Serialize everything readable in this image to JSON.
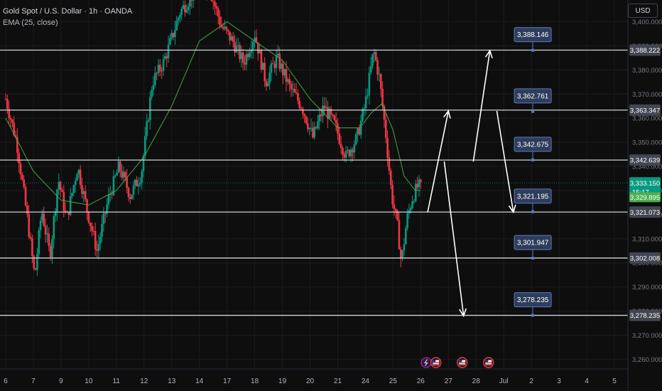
{
  "header": {
    "symbol": "Gold Spot / U.S. Dollar · 1h · OANDA",
    "indicator": "EMA (25, close)"
  },
  "price_scale": {
    "currency": "USD"
  },
  "colors": {
    "background": "#0e0e0e",
    "grid": "#1c1c1c",
    "bull": "#089981",
    "bear": "#f23645",
    "ema": "#4caf50",
    "level_line": "#d1d4dc",
    "label_fill": "#2e3d5b",
    "label_border": "#5b79c2",
    "current_price": "#089981",
    "ema_label": "#4caf50"
  },
  "chart_data": {
    "type": "candlestick",
    "instrument": "Gold Spot / U.S. Dollar",
    "timeframe": "1h",
    "indicator": "EMA (25, close)",
    "ylim": [
      3256,
      3409
    ],
    "y_ticks": [
      3400,
      3390,
      3380,
      3370,
      3360,
      3350,
      3340,
      3330,
      3320,
      3310,
      3300,
      3290,
      3280,
      3270,
      3260
    ],
    "y_tick_labels": [
      "3,400.000",
      "3,390.000",
      "3,380.000",
      "3,370.000",
      "3,360.000",
      "3,350.000",
      "3,340.000",
      "3,330.000",
      "3,320.000",
      "3,310.000",
      "3,300.000",
      "3,290.000",
      "3,280.000",
      "3,270.000",
      "3,260.000"
    ],
    "x_ticks": [
      "6",
      "7",
      "9",
      "10",
      "11",
      "12",
      "13",
      "14",
      "17",
      "18",
      "19",
      "20",
      "21",
      "24",
      "25",
      "26",
      "27",
      "28",
      "Jul",
      "2",
      "3",
      "4",
      "5"
    ],
    "x_tick_index": [
      0,
      1,
      2,
      3,
      4,
      5,
      6,
      7,
      8,
      9,
      10,
      11,
      12,
      13,
      14,
      15,
      16,
      17,
      18,
      19,
      20,
      21,
      22
    ],
    "x_domain": [
      0,
      22
    ],
    "price_path": [
      [
        0.0,
        3368
      ],
      [
        0.4,
        3350
      ],
      [
        0.8,
        3317
      ],
      [
        1.05,
        3294
      ],
      [
        1.3,
        3322
      ],
      [
        1.6,
        3303
      ],
      [
        1.9,
        3335
      ],
      [
        2.2,
        3318
      ],
      [
        2.6,
        3340
      ],
      [
        2.9,
        3324
      ],
      [
        3.3,
        3305
      ],
      [
        3.7,
        3326
      ],
      [
        4.1,
        3340
      ],
      [
        4.5,
        3328
      ],
      [
        4.9,
        3337
      ],
      [
        5.3,
        3375
      ],
      [
        5.7,
        3383
      ],
      [
        6.0,
        3393
      ],
      [
        6.3,
        3404
      ],
      [
        6.8,
        3412
      ],
      [
        7.3,
        3416
      ],
      [
        7.8,
        3398
      ],
      [
        8.2,
        3392
      ],
      [
        8.6,
        3383
      ],
      [
        9.0,
        3395
      ],
      [
        9.4,
        3375
      ],
      [
        9.8,
        3385
      ],
      [
        10.3,
        3372
      ],
      [
        10.7,
        3365
      ],
      [
        11.1,
        3352
      ],
      [
        11.5,
        3365
      ],
      [
        11.9,
        3357
      ],
      [
        12.3,
        3344
      ],
      [
        12.7,
        3352
      ],
      [
        13.0,
        3366
      ],
      [
        13.3,
        3388
      ],
      [
        13.5,
        3377
      ],
      [
        13.75,
        3352
      ],
      [
        13.95,
        3328
      ],
      [
        14.15,
        3316
      ],
      [
        14.3,
        3300
      ],
      [
        14.5,
        3318
      ],
      [
        14.7,
        3327
      ],
      [
        14.9,
        3332
      ],
      [
        15.0,
        3331
      ]
    ],
    "ema_path": [
      [
        0.0,
        3360
      ],
      [
        1.0,
        3338
      ],
      [
        2.0,
        3326
      ],
      [
        3.0,
        3324
      ],
      [
        4.0,
        3330
      ],
      [
        5.0,
        3344
      ],
      [
        6.0,
        3365
      ],
      [
        7.0,
        3392
      ],
      [
        8.0,
        3400
      ],
      [
        9.0,
        3392
      ],
      [
        10.0,
        3384
      ],
      [
        11.0,
        3368
      ],
      [
        12.0,
        3356
      ],
      [
        12.8,
        3356
      ],
      [
        13.2,
        3362
      ],
      [
        13.6,
        3366
      ],
      [
        14.0,
        3355
      ],
      [
        14.4,
        3336
      ],
      [
        14.8,
        3330
      ],
      [
        15.0,
        3330
      ]
    ],
    "horizontal_levels": [
      3388.222,
      3363.347,
      3342.639,
      3321.073,
      3302.008,
      3278.235
    ],
    "horizontal_level_labels": [
      "3,388.222",
      "3,363.347",
      "3,342.639",
      "3,321.073",
      "3,302.008",
      "3,278.235"
    ],
    "level_callouts": [
      3388.146,
      3362.761,
      3342.675,
      3321.195,
      3301.947,
      3278.235
    ],
    "level_callout_labels": [
      "3,388.146",
      "3,362.761",
      "3,342.675",
      "3,321.195",
      "3,301.947",
      "3,278.235"
    ],
    "current_price": 3333.15,
    "current_price_label": "3,333.150",
    "countdown": "15:17",
    "ema_value": 3329.895,
    "ema_value_label": "3,329.895",
    "projection_arrows": [
      {
        "from": [
          15.25,
          3321
        ],
        "to": [
          16.0,
          3363
        ]
      },
      {
        "from": [
          16.9,
          3342
        ],
        "to": [
          17.5,
          3388
        ]
      },
      {
        "from": [
          17.75,
          3363
        ],
        "to": [
          18.35,
          3321
        ]
      },
      {
        "from": [
          15.85,
          3342
        ],
        "to": [
          16.55,
          3278
        ]
      }
    ],
    "event_icons": [
      {
        "x": 15.2,
        "kind": "lightning"
      },
      {
        "x": 15.55,
        "kind": "us-flag"
      },
      {
        "x": 16.5,
        "kind": "us-flag"
      },
      {
        "x": 17.45,
        "kind": "us-flag"
      }
    ]
  }
}
